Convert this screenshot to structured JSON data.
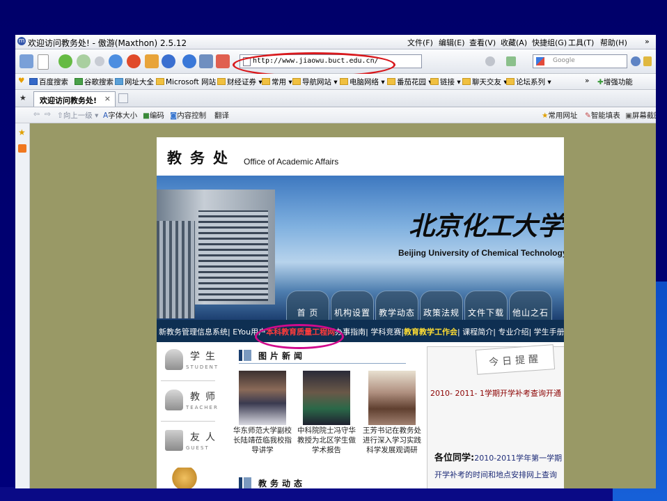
{
  "window": {
    "title": "欢迎访问教务处! - 傲游(Maxthon) 2.5.12",
    "menu": [
      "文件(F)",
      "编辑(E)",
      "查看(V)",
      "收藏(A)",
      "快捷组(G)",
      "工具(T)",
      "帮助(H)"
    ]
  },
  "address": {
    "url": "http://www.jiaowu.buct.edu.cn/"
  },
  "search": {
    "placeholder": "Google"
  },
  "favorites": [
    "百度搜索",
    "谷歌搜索",
    "网址大全",
    "Microsoft 网站",
    "财经证券",
    "常用",
    "导航网站",
    "电脑网络",
    "番茄花园",
    "链接",
    "聊天交友",
    "论坛系列"
  ],
  "favorites_right": "增强功能",
  "tab": {
    "label": "欢迎访问教务处!",
    "close": "×"
  },
  "subtoolbar": {
    "up": "向上一级",
    "font_size": "字体大小",
    "encoding": "编码",
    "content_control": "内容控制",
    "translate": "翻译",
    "common_sites": "常用网址",
    "smart_fill": "智能填表",
    "screenshot": "屏幕截图"
  },
  "site": {
    "office_cn": "教务处",
    "office_en": "Office of Academic Affairs",
    "univ_cn": "北京化工大学",
    "univ_en": "Beijing University of Chemical Technology",
    "nav": [
      "首 页",
      "机构设置",
      "教学动态",
      "政策法规",
      "文件下载",
      "他山之石"
    ],
    "links": {
      "a": "新教务管理信息系统| EYou用户",
      "b": "本科教育质量工程网",
      "c": "办事指南| 学科竞赛|",
      "d": "教育教学工作会",
      "e": "| 课程简介| 专业介绍| 学生手册| 教学通讯|"
    },
    "roles": [
      {
        "cn": "学生",
        "en": "STUDENT"
      },
      {
        "cn": "教师",
        "en": "TEACHER"
      },
      {
        "cn": "友人",
        "en": "GUEST"
      }
    ],
    "news_title": "图片新闻",
    "photos": [
      {
        "caption": "华东师范大学副校长陆靖莅临我校指导讲学"
      },
      {
        "caption": "中科院院士冯守华教授为北区学生做学术报告"
      },
      {
        "caption": "王芳书记在教务处进行深入学习实践科学发展观调研"
      }
    ],
    "news2_title": "教务动态",
    "reminder": {
      "tag": "今日提醒",
      "line": "2010- 2011- 1学期开学补考查询开通",
      "greeting": "各位同学:",
      "body": "2010-2011学年第一学期开学补考的时间和地点安排网上查询"
    }
  },
  "colors": {
    "slide_bg": "#000066",
    "page_bg": "#999966",
    "link_bar": "#0e2f52",
    "highlight_red": "#d8181c",
    "highlight_magenta": "#d10a8c"
  }
}
